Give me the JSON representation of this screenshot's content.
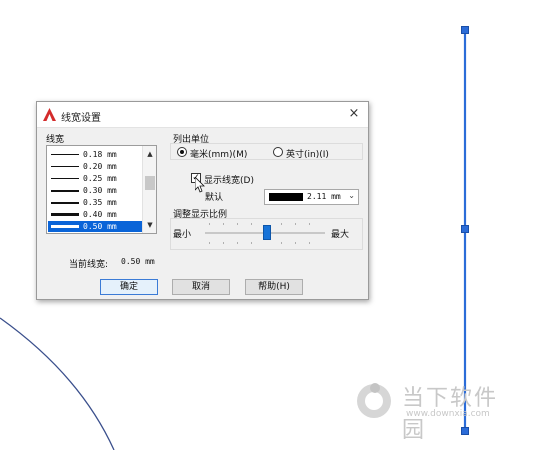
{
  "dialog": {
    "title": "线宽设置",
    "close_glyph": "×",
    "lineweight_group_label": "线宽",
    "lineweights": [
      {
        "label": "0.18 mm",
        "weight": 0.18
      },
      {
        "label": "0.20 mm",
        "weight": 0.2
      },
      {
        "label": "0.25 mm",
        "weight": 0.25
      },
      {
        "label": "0.30 mm",
        "weight": 0.3
      },
      {
        "label": "0.35 mm",
        "weight": 0.35
      },
      {
        "label": "0.40 mm",
        "weight": 0.4
      },
      {
        "label": "0.50 mm",
        "weight": 0.5,
        "selected": true
      }
    ],
    "units_group_label": "列出单位",
    "unit_mm_label": "毫米(mm)(M)",
    "unit_in_label": "英寸(in)(I)",
    "unit_selected": "mm",
    "display_lw_label": "显示线宽(D)",
    "display_lw_checked": true,
    "default_label": "默认",
    "default_value": "2.11 mm",
    "scale_group_label": "调整显示比例",
    "scale_min_label": "最小",
    "scale_max_label": "最大",
    "scale_fraction": 0.5,
    "current_lw_label": "当前线宽:",
    "current_lw_value": "0.50 mm",
    "ok_label": "确定",
    "cancel_label": "取消",
    "help_label": "帮助(H)"
  },
  "watermark": {
    "main_text": "当下软件园",
    "url_text": "www.downxia.com"
  },
  "colors": {
    "accent": "#0a64d8",
    "line_blue": "#2b6cd8",
    "autocad_red": "#d42b2b"
  }
}
